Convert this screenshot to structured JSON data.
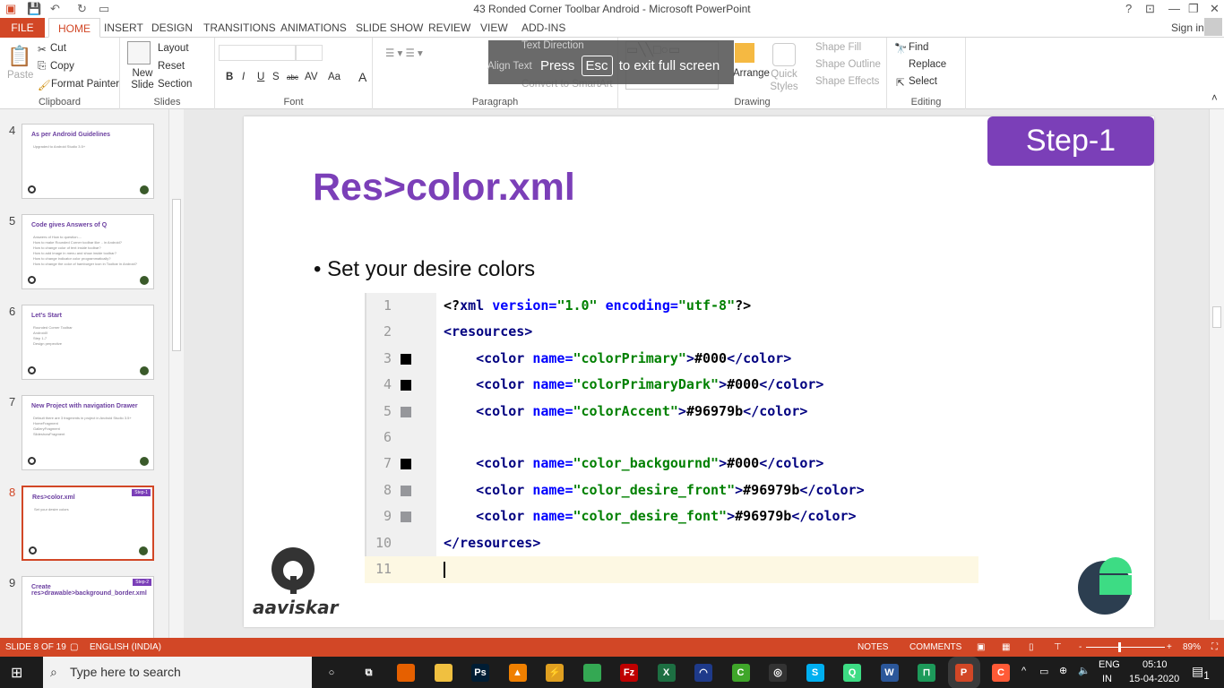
{
  "window": {
    "title": "43 Ronded Corner Toolbar Android - Microsoft PowerPoint",
    "help": "?",
    "sign_in": "Sign in"
  },
  "tabs": [
    "FILE",
    "HOME",
    "INSERT",
    "DESIGN",
    "TRANSITIONS",
    "ANIMATIONS",
    "SLIDE SHOW",
    "REVIEW",
    "VIEW",
    "ADD-INS"
  ],
  "ribbon": {
    "clipboard": {
      "label": "Clipboard",
      "paste": "Paste",
      "cut": "Cut",
      "copy": "Copy",
      "format_painter": "Format Painter"
    },
    "slides": {
      "label": "Slides",
      "new_slide": "New Slide",
      "layout": "Layout",
      "reset": "Reset",
      "section": "Section"
    },
    "font": {
      "label": "Font",
      "bold": "B",
      "italic": "I",
      "underline": "U",
      "shadow": "S",
      "strike": "abc",
      "spacing": "AV",
      "case": "Aa",
      "color": "A"
    },
    "paragraph": {
      "label": "Paragraph",
      "text_direction": "Text Direction",
      "align_text": "Align Text",
      "smartart": "Convert to SmartArt"
    },
    "drawing": {
      "label": "Drawing",
      "arrange": "Arrange",
      "quick_styles": "Quick Styles",
      "shape_fill": "Shape Fill",
      "shape_outline": "Shape Outline",
      "shape_effects": "Shape Effects"
    },
    "editing": {
      "label": "Editing",
      "find": "Find",
      "replace": "Replace",
      "select": "Select"
    }
  },
  "fullscreen_notice": {
    "press": "Press",
    "key": "Esc",
    "rest": "to exit full screen"
  },
  "thumbnails": [
    {
      "num": "4",
      "title": "As per Android Guidelines",
      "lines": [
        "Upgraded to Android Studio 3.5+"
      ]
    },
    {
      "num": "5",
      "title": "Code gives Answers of Q",
      "lines": [
        "Answers of How to question....",
        "How to make Rounded Corner toolbar like .. in Android?",
        "How to change color of text inside toolbar?",
        "How to add image in menu and show inside toolbar?",
        "How to change indicator color programmatically?",
        "How to change the color of hamburger icon in Toolbar in Android?"
      ]
    },
    {
      "num": "6",
      "title": "Let's Start",
      "lines": [
        "Rounded Corner Toolbar",
        "AndroidX",
        "Step 1-7",
        "Design perpective"
      ]
    },
    {
      "num": "7",
      "title": "New Project with navigation Drawer",
      "lines": [
        "Default there are 3 fragments in project in Android Studio 3.5+",
        "HomeFragment",
        "GalleryFragment",
        "SlideshowFragment"
      ]
    },
    {
      "num": "8",
      "title": "Res>color.xml",
      "lines": [
        "Set your desire colors"
      ],
      "badge": "Step-1"
    },
    {
      "num": "9",
      "title": "Create res>drawable>background_border.xml",
      "lines": [],
      "badge": "Step-2"
    }
  ],
  "slide": {
    "step": "Step-1",
    "title": "Res>color.xml",
    "bullet": "Set your desire colors",
    "logo_text": "aaviskar",
    "code": [
      {
        "n": "1",
        "tokens": [
          [
            "pi",
            "<?"
          ],
          [
            "tag",
            "xml "
          ],
          [
            "attr",
            "version="
          ],
          [
            "val",
            "\"1.0\""
          ],
          [
            "txt",
            " "
          ],
          [
            "attr",
            "encoding="
          ],
          [
            "val",
            "\"utf-8\""
          ],
          [
            "pi",
            "?>"
          ]
        ]
      },
      {
        "n": "2",
        "tokens": [
          [
            "tag",
            "<resources>"
          ]
        ]
      },
      {
        "n": "3",
        "swatch": "#000000",
        "tokens": [
          [
            "txt",
            "    "
          ],
          [
            "tag",
            "<color "
          ],
          [
            "attr",
            "name="
          ],
          [
            "val",
            "\"colorPrimary\""
          ],
          [
            "tag",
            ">"
          ],
          [
            "txt",
            "#000"
          ],
          [
            "tag",
            "</color>"
          ]
        ]
      },
      {
        "n": "4",
        "swatch": "#000000",
        "tokens": [
          [
            "txt",
            "    "
          ],
          [
            "tag",
            "<color "
          ],
          [
            "attr",
            "name="
          ],
          [
            "val",
            "\"colorPrimaryDark\""
          ],
          [
            "tag",
            ">"
          ],
          [
            "txt",
            "#000"
          ],
          [
            "tag",
            "</color>"
          ]
        ]
      },
      {
        "n": "5",
        "swatch": "#96979b",
        "tokens": [
          [
            "txt",
            "    "
          ],
          [
            "tag",
            "<color "
          ],
          [
            "attr",
            "name="
          ],
          [
            "val",
            "\"colorAccent\""
          ],
          [
            "tag",
            ">"
          ],
          [
            "txt",
            "#96979b"
          ],
          [
            "tag",
            "</color>"
          ]
        ]
      },
      {
        "n": "6",
        "tokens": []
      },
      {
        "n": "7",
        "swatch": "#000000",
        "tokens": [
          [
            "txt",
            "    "
          ],
          [
            "tag",
            "<color "
          ],
          [
            "attr",
            "name="
          ],
          [
            "val",
            "\"color_backgournd\""
          ],
          [
            "tag",
            ">"
          ],
          [
            "txt",
            "#000"
          ],
          [
            "tag",
            "</color>"
          ]
        ]
      },
      {
        "n": "8",
        "swatch": "#96979b",
        "tokens": [
          [
            "txt",
            "    "
          ],
          [
            "tag",
            "<color "
          ],
          [
            "attr",
            "name="
          ],
          [
            "val",
            "\"color_desire_front\""
          ],
          [
            "tag",
            ">"
          ],
          [
            "txt",
            "#96979b"
          ],
          [
            "tag",
            "</color>"
          ]
        ]
      },
      {
        "n": "9",
        "swatch": "#96979b",
        "tokens": [
          [
            "txt",
            "    "
          ],
          [
            "tag",
            "<color "
          ],
          [
            "attr",
            "name="
          ],
          [
            "val",
            "\"color_desire_font\""
          ],
          [
            "tag",
            ">"
          ],
          [
            "txt",
            "#96979b"
          ],
          [
            "tag",
            "</color>"
          ]
        ]
      },
      {
        "n": "10",
        "tokens": [
          [
            "tag",
            "</resources>"
          ]
        ]
      },
      {
        "n": "11",
        "tokens": [],
        "current": true
      }
    ]
  },
  "status": {
    "slide": "SLIDE 8 OF 19",
    "language": "ENGLISH (INDIA)",
    "notes": "NOTES",
    "comments": "COMMENTS",
    "zoom": "89%",
    "zoom_minus": "-",
    "zoom_plus": "+"
  },
  "taskbar": {
    "search_placeholder": "Type here to search",
    "lang1": "ENG",
    "lang2": "IN",
    "time": "05:10",
    "date": "15-04-2020",
    "notif": "1",
    "apps": [
      {
        "name": "cortana",
        "c": "#1c1c1c",
        "t": "○"
      },
      {
        "name": "task-view",
        "c": "#1c1c1c",
        "t": "⧉"
      },
      {
        "name": "firefox",
        "c": "#e66000",
        "t": ""
      },
      {
        "name": "file-explorer",
        "c": "#f0c040",
        "t": ""
      },
      {
        "name": "photoshop",
        "c": "#001d34",
        "t": "Ps"
      },
      {
        "name": "vlc",
        "c": "#f08000",
        "t": "▲"
      },
      {
        "name": "winamp",
        "c": "#e0a020",
        "t": "⚡"
      },
      {
        "name": "chrome",
        "c": "#34a853",
        "t": ""
      },
      {
        "name": "filezilla",
        "c": "#bf0000",
        "t": "Fz"
      },
      {
        "name": "excel",
        "c": "#1d6f42",
        "t": "X"
      },
      {
        "name": "app-blue",
        "c": "#1e3a8a",
        "t": "◠"
      },
      {
        "name": "camtasia",
        "c": "#3fa62a",
        "t": "C"
      },
      {
        "name": "obs",
        "c": "#333",
        "t": "◎"
      },
      {
        "name": "skype",
        "c": "#00aff0",
        "t": "S"
      },
      {
        "name": "android-studio",
        "c": "#3ddc84",
        "t": "Q"
      },
      {
        "name": "word",
        "c": "#2b579a",
        "t": "W"
      },
      {
        "name": "app-green",
        "c": "#1d9a5a",
        "t": "⊓"
      },
      {
        "name": "powerpoint",
        "c": "#d24726",
        "t": "P"
      },
      {
        "name": "camtasia-recorder",
        "c": "#ff5a36",
        "t": "C"
      }
    ]
  }
}
